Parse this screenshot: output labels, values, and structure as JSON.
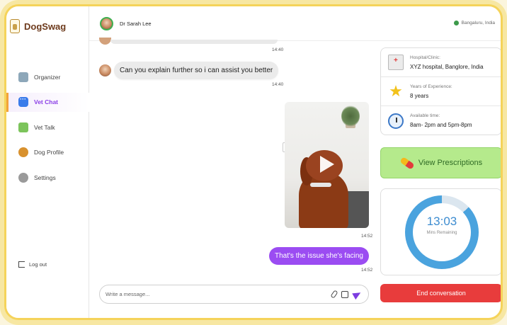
{
  "app": {
    "name": "DogSwag"
  },
  "sidebar": {
    "items": [
      {
        "label": "Organizer",
        "icon": "organizer-icon"
      },
      {
        "label": "Vet Chat",
        "icon": "chat-icon",
        "active": true
      },
      {
        "label": "Vet Talk",
        "icon": "video-icon"
      },
      {
        "label": "Dog Profile",
        "icon": "dog-icon"
      },
      {
        "label": "Settings",
        "icon": "gear-icon"
      }
    ],
    "logout_label": "Log out"
  },
  "header": {
    "doctor_name": "Dr Sarah Lee",
    "location": "Bangaluru, India"
  },
  "chat": {
    "messages": [
      {
        "time": "14:40"
      },
      {
        "text": "Can you explain further so i can assist you better",
        "time": "14:40"
      },
      {
        "type": "video",
        "time": "14:52"
      },
      {
        "text": "That's the issue she's facing",
        "time": "14:52"
      }
    ],
    "composer_placeholder": "Write a message..."
  },
  "details": {
    "hospital_label": "Hospital/Clinic:",
    "hospital_value": "XYZ hospital, Banglore, India",
    "experience_label": "Years of Experience:",
    "experience_value": "8 years",
    "available_label": "Available time:",
    "available_value": "8am- 2pm and 5pm-8pm"
  },
  "prescriptions_label": "View Prescriptions",
  "timer": {
    "time": "13:03",
    "label": "Mins Remaining",
    "progress_remaining": 0.87
  },
  "end_label": "End conversation",
  "colors": {
    "accent": "#9b4cf2",
    "end": "#e83c3c",
    "prescription_bg": "#b5ea8c",
    "timer": "#4aa3de",
    "frame": "#f5d35a"
  }
}
